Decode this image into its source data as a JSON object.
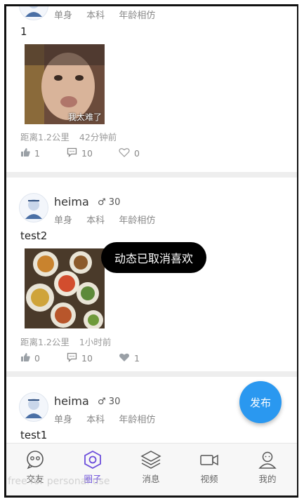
{
  "posts": [
    {
      "username": "",
      "tags": [
        "单身",
        "本科",
        "年龄相仿"
      ],
      "text": "1",
      "image_caption": "我太难了",
      "distance": "距离1.2公里",
      "time": "42分钟前",
      "likes": "1",
      "comments": "10",
      "loves": "0"
    },
    {
      "username": "heima",
      "age": "30",
      "tags": [
        "单身",
        "本科",
        "年龄相仿"
      ],
      "text": "test2",
      "distance": "距离1.2公里",
      "time": "1小时前",
      "likes": "0",
      "comments": "10",
      "loves": "1"
    },
    {
      "username": "heima",
      "age": "30",
      "tags": [
        "单身",
        "本科",
        "年龄相仿"
      ],
      "text": "test1"
    }
  ],
  "toast": "动态已取消喜欢",
  "fab_label": "发布",
  "tabs": [
    {
      "label": "交友",
      "icon": "chat-face-icon"
    },
    {
      "label": "圈子",
      "icon": "hexagon-circle-icon",
      "active": true
    },
    {
      "label": "消息",
      "icon": "layers-icon"
    },
    {
      "label": "视频",
      "icon": "video-camera-icon"
    },
    {
      "label": "我的",
      "icon": "person-icon"
    }
  ],
  "watermark": "free for personal use",
  "colors": {
    "accent": "#6a4cdb",
    "fab": "#2a98f0",
    "toast_bg": "#000000"
  }
}
